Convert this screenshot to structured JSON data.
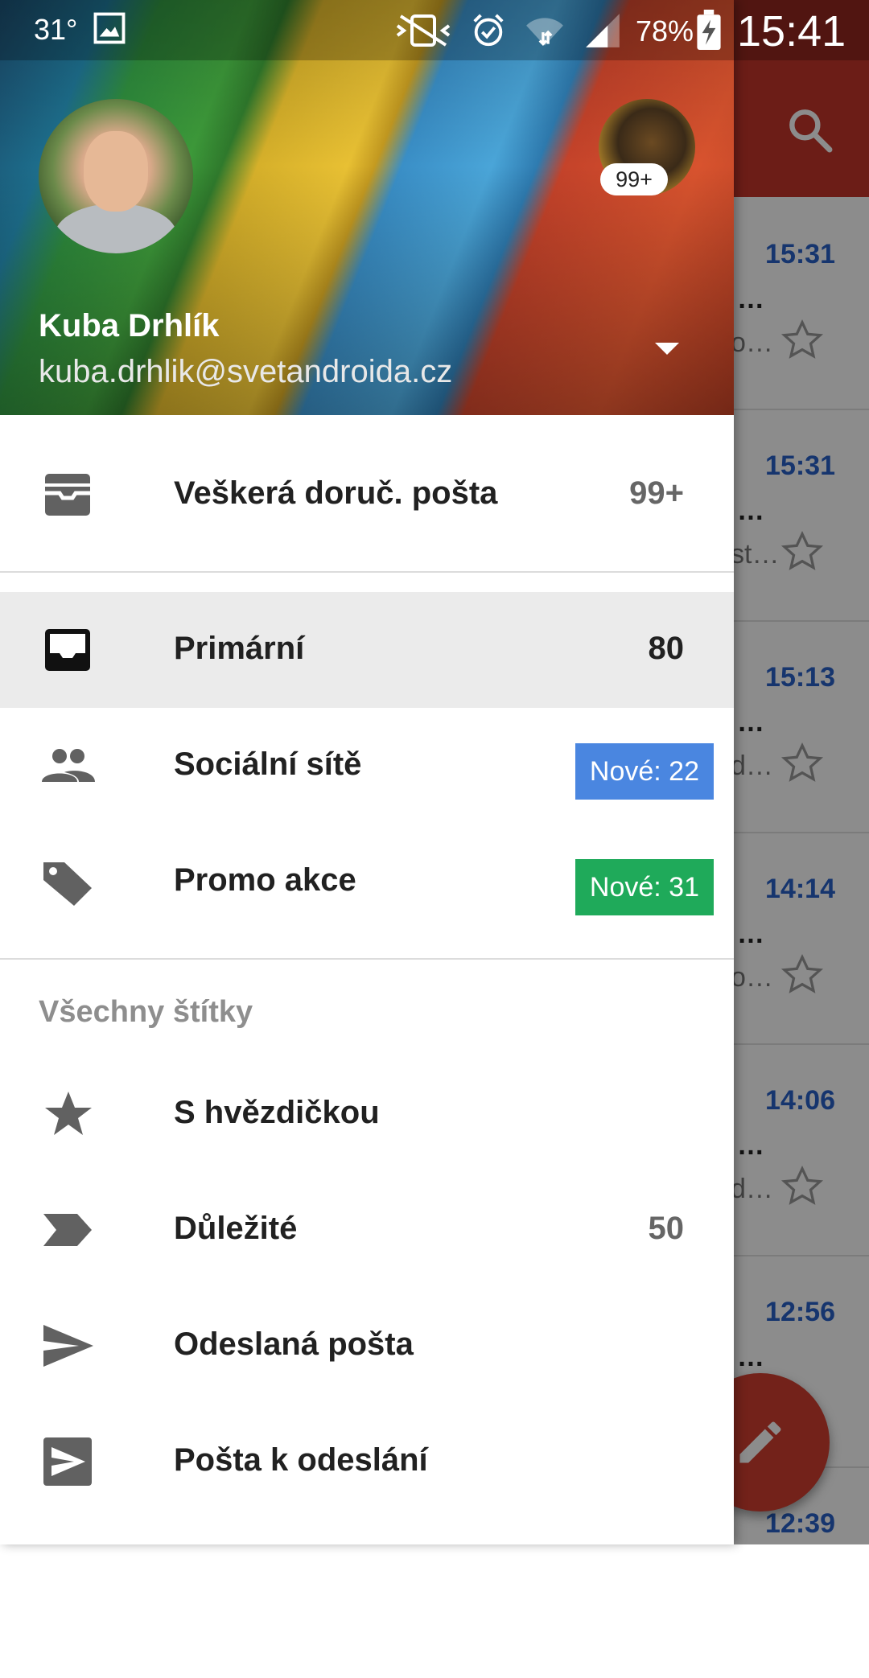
{
  "status_bar": {
    "temperature": "31°",
    "battery": "78%",
    "time": "15:41",
    "icons": [
      "image-icon",
      "vibrate-icon",
      "alarm-icon",
      "wifi-icon",
      "signal-icon",
      "battery-charging-icon"
    ]
  },
  "background_list": {
    "rows": [
      {
        "time": "15:31",
        "sender": "…",
        "snippet": "o…"
      },
      {
        "time": "15:31",
        "sender": "…",
        "snippet": "st…"
      },
      {
        "time": "15:13",
        "sender": "…",
        "snippet": "d…"
      },
      {
        "time": "14:14",
        "sender": "…",
        "snippet": "o…"
      },
      {
        "time": "14:06",
        "sender": "…",
        "snippet": "d…"
      },
      {
        "time": "12:56",
        "sender": "…",
        "snippet": ""
      },
      {
        "time": "12:39",
        "sender": "",
        "snippet": ""
      }
    ]
  },
  "account": {
    "name": "Kuba Drhlík",
    "email": "kuba.drhlik@svetandroida.cz",
    "other_account_badge": "99+"
  },
  "nav": {
    "all_inboxes": {
      "label": "Veškerá doruč. pošta",
      "count": "99+"
    },
    "primary": {
      "label": "Primární",
      "count": "80"
    },
    "social": {
      "label": "Sociální sítě",
      "badge": "Nové: 22",
      "badge_color": "#4a86e0"
    },
    "promo": {
      "label": "Promo akce",
      "badge": "Nové: 31",
      "badge_color": "#1faa5a"
    },
    "section_all_labels": "Všechny štítky",
    "starred": {
      "label": "S hvězdičkou"
    },
    "important": {
      "label": "Důležité",
      "count": "50"
    },
    "sent": {
      "label": "Odeslaná pošta"
    },
    "outbox": {
      "label": "Pošta k odeslání"
    }
  }
}
